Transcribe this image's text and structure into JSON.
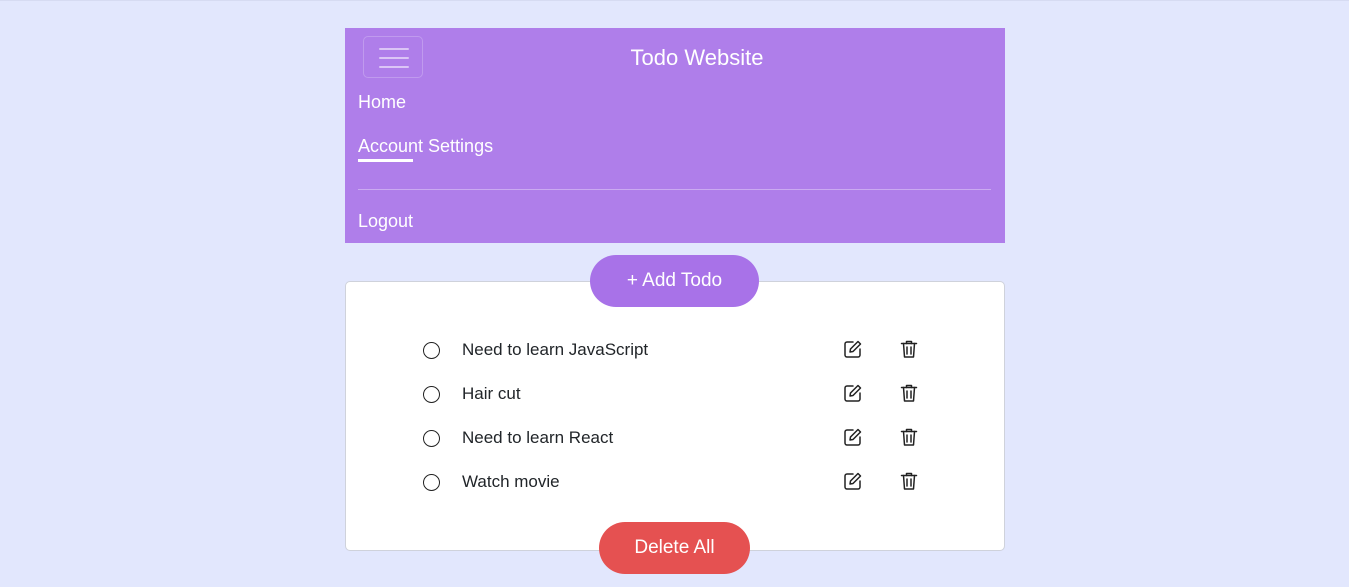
{
  "navbar": {
    "brand": "Todo Website",
    "toggler_icon": "hamburger-menu-icon",
    "links": {
      "home": "Home",
      "account_settings": "Account Settings",
      "logout": "Logout"
    },
    "active_link": "Account Settings",
    "background_color": "#af7eea"
  },
  "actions": {
    "add_todo_label": "+ Add Todo",
    "delete_all_label": "Delete All",
    "add_color": "#a872e8",
    "delete_color": "#e55151"
  },
  "todos": [
    {
      "text": "Need to learn JavaScript",
      "completed": false
    },
    {
      "text": "Hair cut",
      "completed": false
    },
    {
      "text": "Need to learn React",
      "completed": false
    },
    {
      "text": "Watch movie",
      "completed": false
    }
  ],
  "icons": {
    "complete": "circle-icon",
    "edit": "edit-icon",
    "delete": "trash-icon"
  },
  "page_background": "#e2e7fd"
}
